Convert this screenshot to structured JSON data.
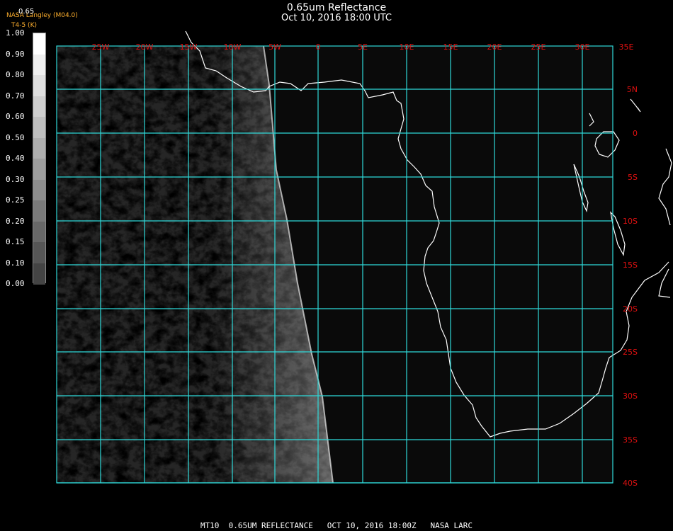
{
  "header": {
    "title": "0.65um Reflectance",
    "datetime": "Oct 10, 2016 18:00 UTC",
    "credit_line1": "NASA Langley (M04.0)",
    "credit_line2": "T4-5 (K)",
    "band_label": "0.65"
  },
  "colorbar": {
    "labels": [
      "1.00",
      "0.90",
      "0.80",
      "0.70",
      "0.60",
      "0.50",
      "0.40",
      "0.30",
      "0.25",
      "0.20",
      "0.15",
      "0.10",
      "0.00"
    ]
  },
  "map": {
    "lon_labels": [
      "25W",
      "20W",
      "15W",
      "10W",
      "5W",
      "0",
      "5E",
      "10E",
      "15E",
      "20E",
      "25E",
      "30E",
      "35E"
    ],
    "lat_labels": [
      "5N",
      "0",
      "5S",
      "10S",
      "15S",
      "20S",
      "25S",
      "30S",
      "35S",
      "40S"
    ],
    "grid_color": "#2fd9d9",
    "label_color": "#e01010",
    "coast_color": "#ffffff"
  },
  "footer": {
    "text": "MT10  0.65UM REFLECTANCE   OCT 10, 2016 18:00Z   NASA LARC"
  }
}
